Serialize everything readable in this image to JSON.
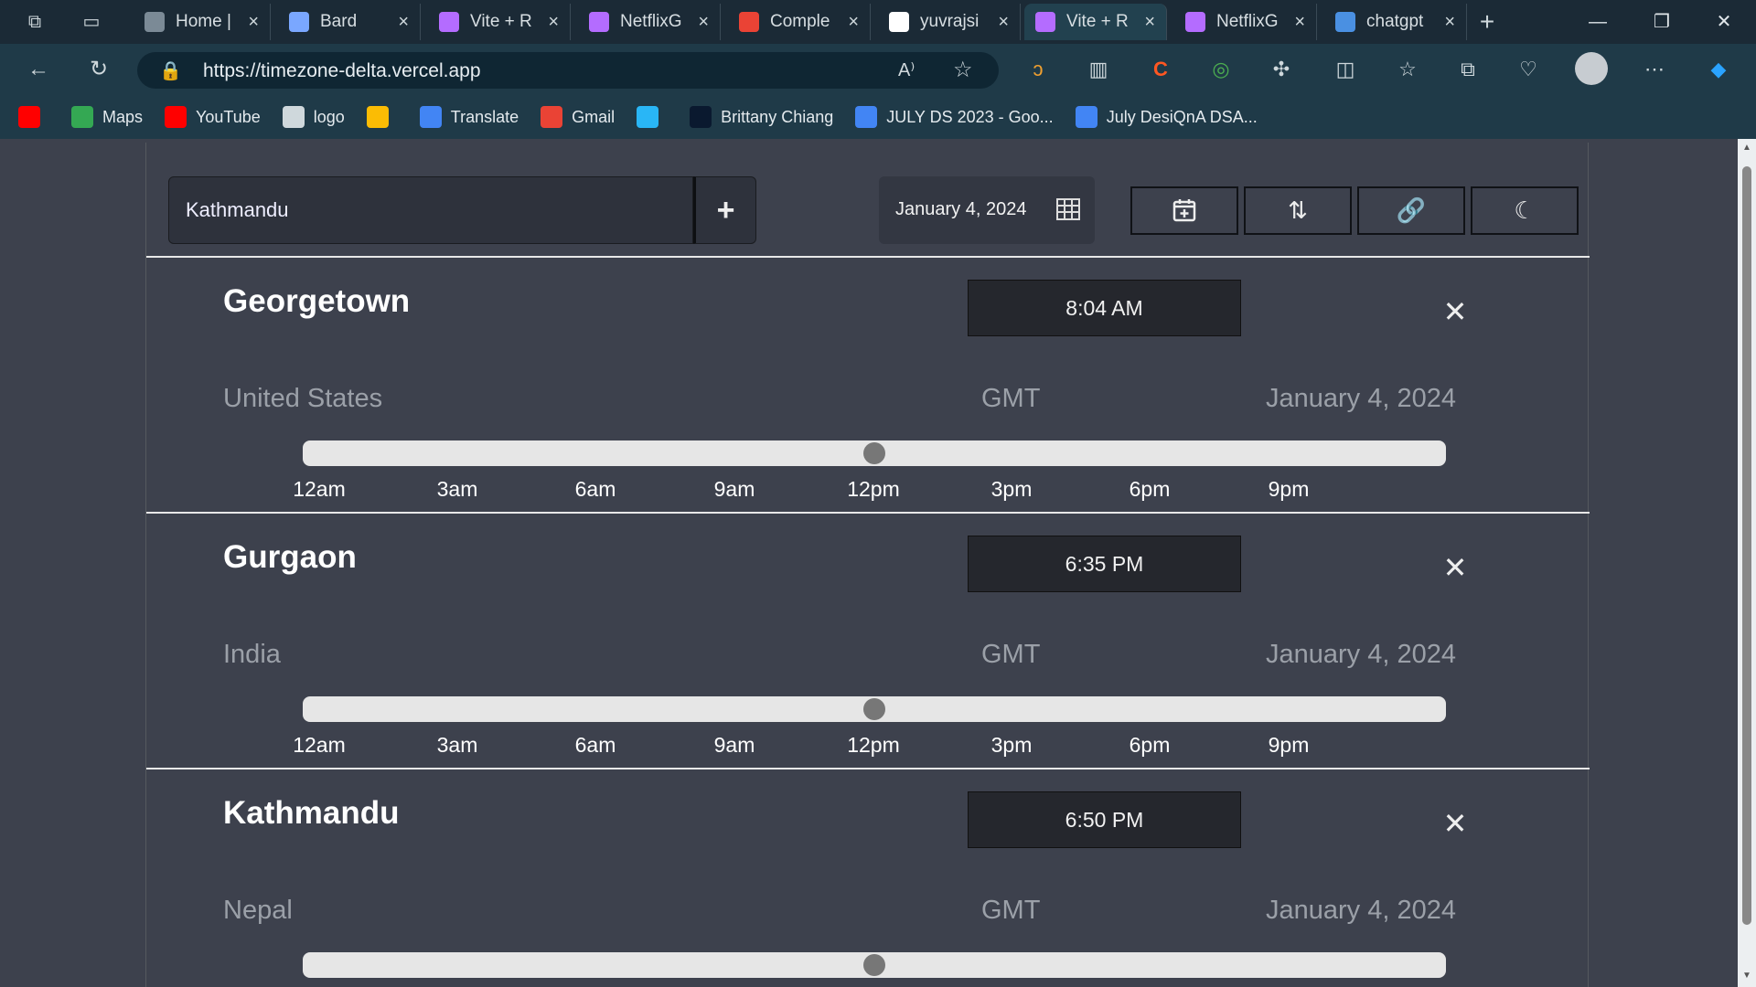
{
  "browser": {
    "tabs": [
      {
        "label": "Home |",
        "icon": "word-icon",
        "color": "#7b8a96"
      },
      {
        "label": "Bard",
        "icon": "bard-icon",
        "color": "#7aa7ff"
      },
      {
        "label": "Vite + R",
        "icon": "vite-icon",
        "color": "#b46cff"
      },
      {
        "label": "NetflixG",
        "icon": "vite-icon",
        "color": "#b46cff"
      },
      {
        "label": "Comple",
        "icon": "gmail-icon",
        "color": "#ea4335"
      },
      {
        "label": "yuvrajsi",
        "icon": "github-icon",
        "color": "#ffffff"
      },
      {
        "label": "Vite + R",
        "icon": "vite-icon",
        "color": "#b46cff"
      },
      {
        "label": "NetflixG",
        "icon": "vite-icon",
        "color": "#b46cff"
      },
      {
        "label": "chatgpt",
        "icon": "search-icon",
        "color": "#4a90e2"
      }
    ],
    "url": "https://timezone-delta.vercel.app",
    "bookmarks": [
      {
        "label": "",
        "icon": "youtube-icon",
        "color": "#ff0000"
      },
      {
        "label": "Maps",
        "icon": "maps-icon",
        "color": "#34a853"
      },
      {
        "label": "YouTube",
        "icon": "youtube-icon",
        "color": "#ff0000"
      },
      {
        "label": "logo",
        "icon": "file-icon",
        "color": "#cfd8dc"
      },
      {
        "label": "",
        "icon": "chart-icon",
        "color": "#fbbc04"
      },
      {
        "label": "Translate",
        "icon": "translate-icon",
        "color": "#4285f4"
      },
      {
        "label": "Gmail",
        "icon": "gmail-icon",
        "color": "#ea4335"
      },
      {
        "label": "",
        "icon": "j-icon",
        "color": "#29b6f6"
      },
      {
        "label": "Brittany Chiang",
        "icon": "b-icon",
        "color": "#0a192f"
      },
      {
        "label": "JULY DS 2023 - Goo...",
        "icon": "docs-icon",
        "color": "#4285f4"
      },
      {
        "label": "July DesiQnA DSA...",
        "icon": "docs-icon",
        "color": "#4285f4"
      }
    ]
  },
  "toolbar": {
    "city_value": "Kathmandu",
    "add_label": "+",
    "date_value": "January 4, 2024"
  },
  "zones": [
    {
      "city": "Georgetown",
      "time": "8:04 AM",
      "country": "United States",
      "tz": "GMT",
      "date": "January 4, 2024",
      "slider_fraction": 0.5
    },
    {
      "city": "Gurgaon",
      "time": "6:35 PM",
      "country": "India",
      "tz": "GMT",
      "date": "January 4, 2024",
      "slider_fraction": 0.5
    },
    {
      "city": "Kathmandu",
      "time": "6:50 PM",
      "country": "Nepal",
      "tz": "GMT",
      "date": "January 4, 2024",
      "slider_fraction": 0.5
    }
  ],
  "hour_ticks": [
    "12am",
    "3am",
    "6am",
    "9am",
    "12pm",
    "3pm",
    "6pm",
    "9pm"
  ]
}
